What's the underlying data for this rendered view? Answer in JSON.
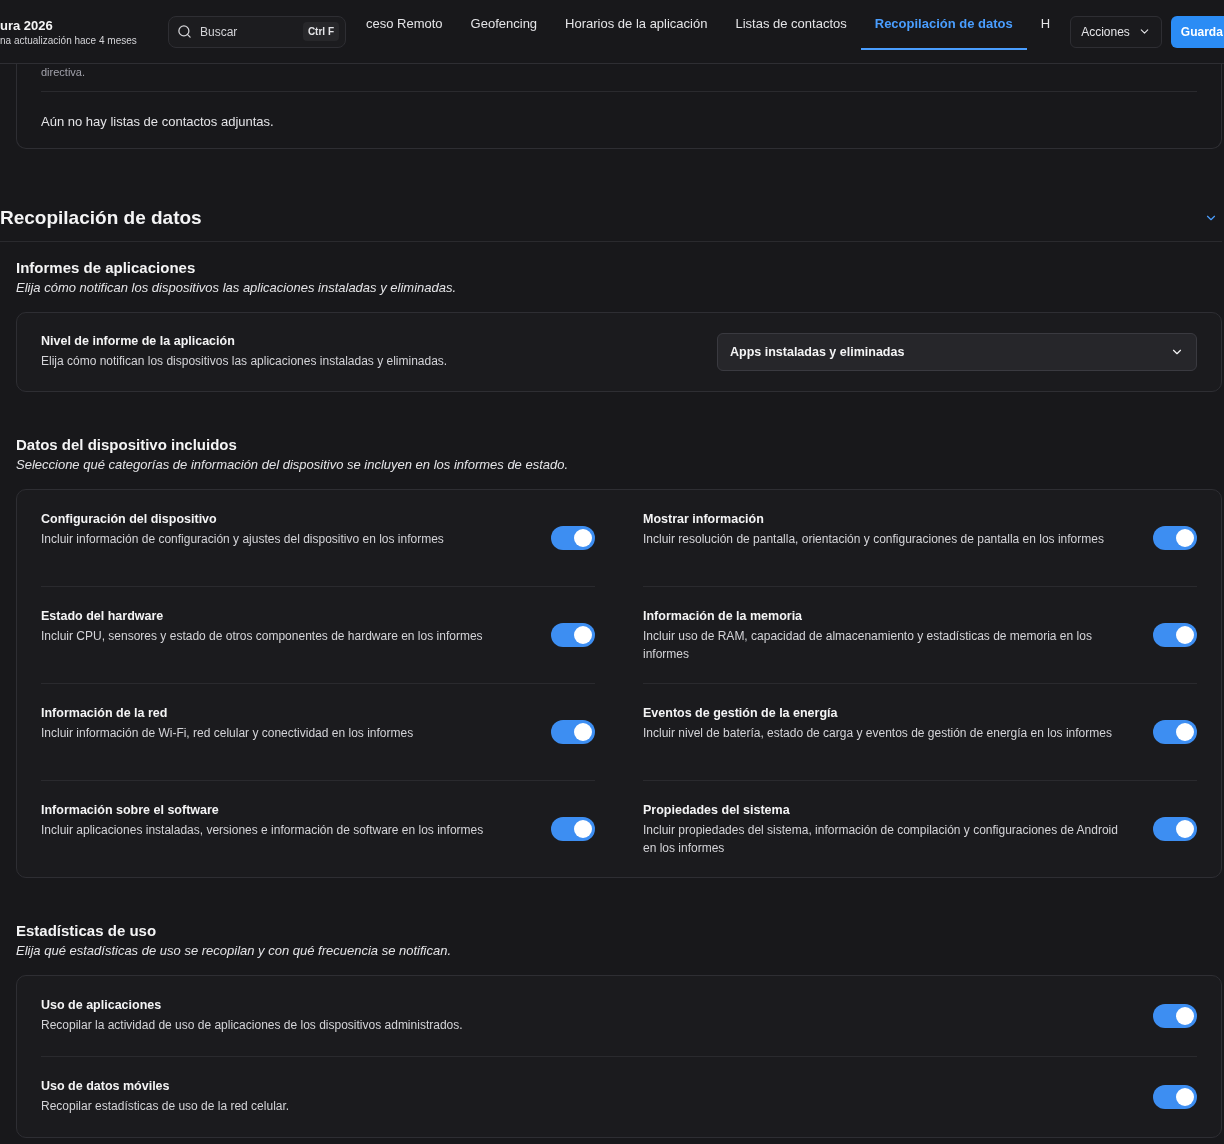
{
  "header": {
    "title": "ura 2026",
    "subtitle": "na actualización hace 4 meses",
    "search": {
      "placeholder": "Buscar",
      "shortcut": "Ctrl F"
    },
    "tabs": [
      {
        "label": "ceso Remoto",
        "selected": false
      },
      {
        "label": "Geofencing",
        "selected": false
      },
      {
        "label": "Horarios de la aplicación",
        "selected": false
      },
      {
        "label": "Listas de contactos",
        "selected": false
      },
      {
        "label": "Recopilación de datos",
        "selected": true
      },
      {
        "label": "H",
        "selected": false
      }
    ],
    "actions_button": "Acciones",
    "save_button": "Guarda"
  },
  "previous_card": {
    "cut_text": "directiva.",
    "empty_text": "Aún no hay listas de contactos adjuntas."
  },
  "section": {
    "title": "Recopilación de datos",
    "expanded": true,
    "groups": [
      {
        "kind": "select",
        "title": "Informes de aplicaciones",
        "description": "Elija cómo notifican los dispositivos las aplicaciones instaladas y eliminadas.",
        "items": [
          {
            "label": "Nivel de informe de la aplicación",
            "help": "Elija cómo notifican los dispositivos las aplicaciones instaladas y eliminadas.",
            "value": "Apps instaladas y eliminadas"
          }
        ]
      },
      {
        "kind": "toggle-grid",
        "title": "Datos del dispositivo incluidos",
        "description": "Seleccione qué categorías de información del dispositivo se incluyen en los informes de estado.",
        "items": [
          {
            "label": "Configuración del dispositivo",
            "help": "Incluir información de configuración y ajustes del dispositivo en los informes",
            "on": true
          },
          {
            "label": "Mostrar información",
            "help": "Incluir resolución de pantalla, orientación y configuraciones de pantalla en los informes",
            "on": true
          },
          {
            "label": "Estado del hardware",
            "help": "Incluir CPU, sensores y estado de otros componentes de hardware en los informes",
            "on": true
          },
          {
            "label": "Información de la memoria",
            "help": "Incluir uso de RAM, capacidad de almacenamiento y estadísticas de memoria en los informes",
            "on": true
          },
          {
            "label": "Información de la red",
            "help": "Incluir información de Wi-Fi, red celular y conectividad en los informes",
            "on": true
          },
          {
            "label": "Eventos de gestión de la energía",
            "help": "Incluir nivel de batería, estado de carga y eventos de gestión de energía en los informes",
            "on": true
          },
          {
            "label": "Información sobre el software",
            "help": "Incluir aplicaciones instaladas, versiones e información de software en los informes",
            "on": true
          },
          {
            "label": "Propiedades del sistema",
            "help": "Incluir propiedades del sistema, información de compilación y configuraciones de Android en los informes",
            "on": true
          }
        ]
      },
      {
        "kind": "toggle-list",
        "title": "Estadísticas de uso",
        "description": "Elija qué estadísticas de uso se recopilan y con qué frecuencia se notifican.",
        "items": [
          {
            "label": "Uso de aplicaciones",
            "help": "Recopilar la actividad de uso de aplicaciones de los dispositivos administrados.",
            "on": true
          },
          {
            "label": "Uso de datos móviles",
            "help": "Recopilar estadísticas de uso de la red celular.",
            "on": true
          }
        ]
      }
    ]
  }
}
